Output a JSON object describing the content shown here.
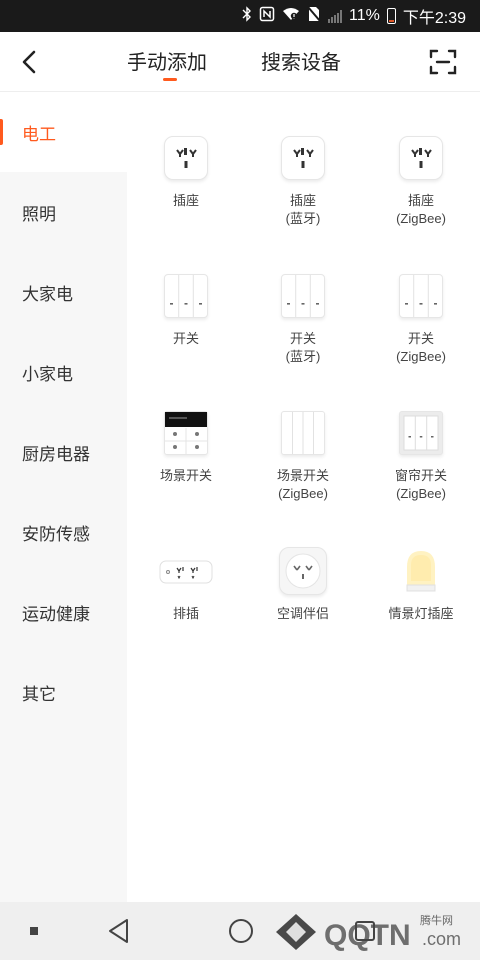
{
  "status_bar": {
    "battery": "11%",
    "time": "下午2:39"
  },
  "header": {
    "tabs": [
      {
        "label": "手动添加"
      },
      {
        "label": "搜索设备"
      }
    ],
    "accent": "#ff5a1e"
  },
  "sidebar": {
    "items": [
      {
        "label": "电工",
        "active": true
      },
      {
        "label": "照明"
      },
      {
        "label": "大家电"
      },
      {
        "label": "小家电"
      },
      {
        "label": "厨房电器"
      },
      {
        "label": "安防传感"
      },
      {
        "label": "运动健康"
      },
      {
        "label": "其它"
      }
    ]
  },
  "devices": [
    {
      "label": "插座",
      "icon": "socket-icon"
    },
    {
      "label": "插座\n(蓝牙)",
      "icon": "socket-icon"
    },
    {
      "label": "插座\n(ZigBee)",
      "icon": "socket-icon"
    },
    {
      "label": "开关",
      "icon": "switch-icon"
    },
    {
      "label": "开关\n(蓝牙)",
      "icon": "switch-icon"
    },
    {
      "label": "开关\n(ZigBee)",
      "icon": "switch-icon"
    },
    {
      "label": "场景开关",
      "icon": "scene-switch-icon"
    },
    {
      "label": "场景开关\n(ZigBee)",
      "icon": "scene-switch-icon"
    },
    {
      "label": "窗帘开关\n(ZigBee)",
      "icon": "curtain-switch-icon"
    },
    {
      "label": "排插",
      "icon": "power-strip-icon"
    },
    {
      "label": "空调伴侣",
      "icon": "ac-companion-icon"
    },
    {
      "label": "情景灯插座",
      "icon": "night-light-icon"
    }
  ],
  "watermark": {
    "brand": "QQTN",
    "domain": ".com",
    "site": "腾牛网"
  }
}
